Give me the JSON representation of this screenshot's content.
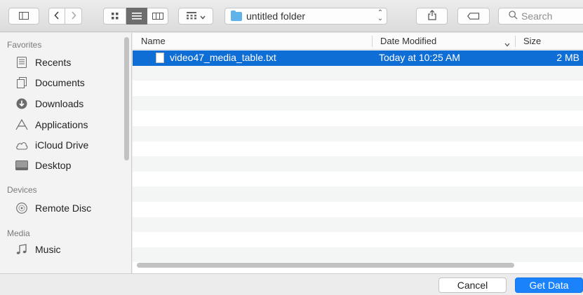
{
  "toolbar": {
    "path_folder": "untitled folder",
    "search_placeholder": "Search"
  },
  "sidebar": {
    "sections": [
      {
        "heading": "Favorites",
        "items": [
          {
            "label": "Recents",
            "icon": "recents-icon"
          },
          {
            "label": "Documents",
            "icon": "documents-icon"
          },
          {
            "label": "Downloads",
            "icon": "downloads-icon"
          },
          {
            "label": "Applications",
            "icon": "applications-icon"
          },
          {
            "label": "iCloud Drive",
            "icon": "icloud-icon"
          },
          {
            "label": "Desktop",
            "icon": "desktop-icon"
          }
        ]
      },
      {
        "heading": "Devices",
        "items": [
          {
            "label": "Remote Disc",
            "icon": "remote-disc-icon"
          }
        ]
      },
      {
        "heading": "Media",
        "items": [
          {
            "label": "Music",
            "icon": "music-icon"
          }
        ]
      }
    ]
  },
  "list": {
    "columns": {
      "name": "Name",
      "date": "Date Modified",
      "size": "Size"
    },
    "files": [
      {
        "name": "video47_media_table.txt",
        "date": "Today at 10:25 AM",
        "size": "2 MB",
        "selected": true
      }
    ]
  },
  "buttons": {
    "cancel": "Cancel",
    "primary": "Get Data"
  },
  "colors": {
    "selection": "#0f6ed6",
    "primary_button": "#1a82fb",
    "folder": "#5fb2ea"
  }
}
